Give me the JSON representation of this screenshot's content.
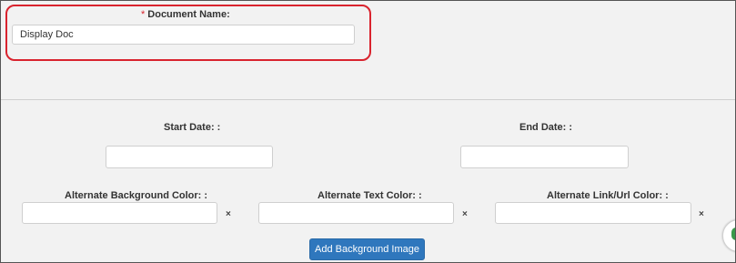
{
  "document_name": {
    "required_marker": "*",
    "label": "Document Name:",
    "value": "Display Doc"
  },
  "dates": {
    "start_label": "Start Date: :",
    "start_value": "",
    "end_label": "End Date: :",
    "end_value": ""
  },
  "colors": {
    "background_label": "Alternate Background Color: :",
    "text_label": "Alternate Text Color: :",
    "link_label": "Alternate Link/Url Color: :",
    "clear_symbol": "×"
  },
  "actions": {
    "add_background_image": "Add Background Image"
  },
  "theme": {
    "highlight": "#d9232e",
    "button": "#2f77bd",
    "badge": "#3a9a4a"
  }
}
